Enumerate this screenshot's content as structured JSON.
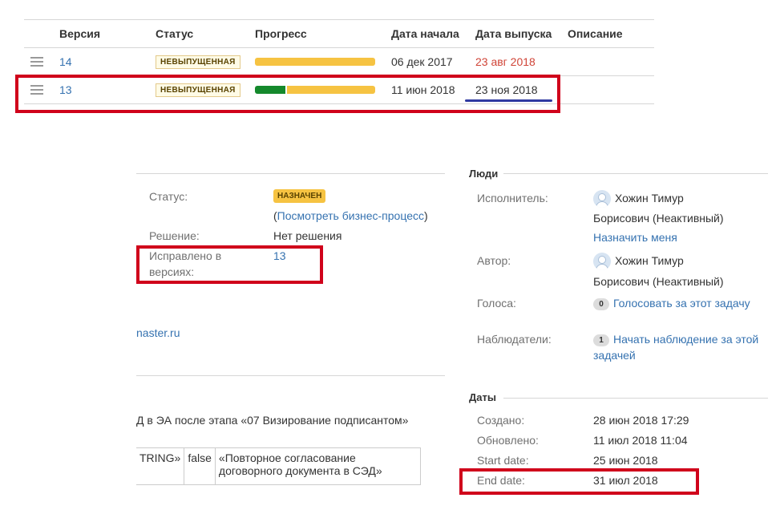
{
  "versions_table": {
    "columns": [
      "Версия",
      "Статус",
      "Прогресс",
      "Дата начала",
      "Дата выпуска",
      "Описание"
    ],
    "rows": [
      {
        "version": "14",
        "status": "НЕВЫПУЩЕННАЯ",
        "progress_done": 0.0,
        "start_date": "06 дек 2017",
        "release_date": "23 авг 2018",
        "release_overdue": true
      },
      {
        "version": "13",
        "status": "НЕВЫПУЩЕННАЯ",
        "progress_done": 0.25,
        "start_date": "11 июн 2018",
        "release_date": "23 ноя 2018",
        "release_overdue": false
      }
    ]
  },
  "details": {
    "status_label": "Статус:",
    "status_value": "НАЗНАЧЕН",
    "workflow_open": "(",
    "workflow_link": "Посмотреть бизнес-процесс",
    "workflow_close": ")",
    "resolution_label": "Решение:",
    "resolution_value": "Нет решения",
    "fix_versions_label_1": "Исправлено в",
    "fix_versions_label_2": "версиях:",
    "fix_versions_value": "13",
    "cut_link": "naster.ru",
    "cut_text": "Д в ЭА после этапа «07 Визирование подписантом»",
    "table_cells": [
      "TRING»",
      "false",
      "«Повторное согласование",
      "договорного документа в СЭД»"
    ]
  },
  "people": {
    "title": "Люди",
    "assignee_label": "Исполнитель:",
    "assignee_name_1": "Хожин Тимур",
    "assignee_name_2": "Борисович (Неактивный)",
    "assign_me": "Назначить меня",
    "reporter_label": "Автор:",
    "reporter_name_1": "Хожин Тимур",
    "reporter_name_2": "Борисович (Неактивный)",
    "votes_label": "Голоса:",
    "votes_count": "0",
    "votes_link": "Голосовать за этот задачу",
    "watchers_label": "Наблюдатели:",
    "watchers_count": "1",
    "watch_link_1": "Начать наблюдение за этой",
    "watch_link_2": "задачей"
  },
  "dates": {
    "title": "Даты",
    "created_label": "Создано:",
    "created_value": "28 июн 2018 17:29",
    "updated_label": "Обновлено:",
    "updated_value": "11 июл 2018 11:04",
    "start_label": "Start date:",
    "start_value": "25 июн 2018",
    "end_label": "End date:",
    "end_value": "31 июл 2018"
  },
  "colors": {
    "annotation_red": "#d0021b",
    "annotation_blue": "#2f3aa1",
    "link": "#3572b0",
    "overdue": "#d04437",
    "progress_done": "#14892c",
    "progress_todo": "#f6c342"
  }
}
